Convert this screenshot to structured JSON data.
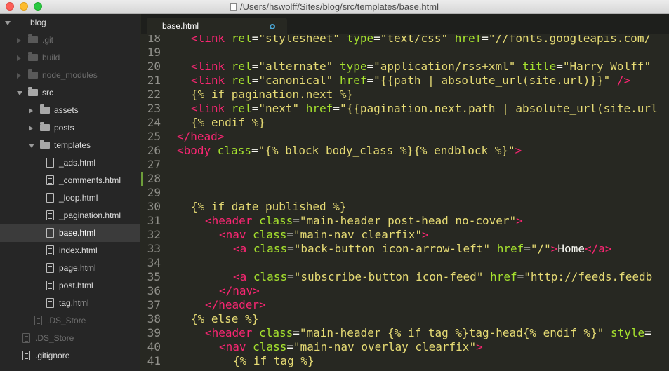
{
  "window": {
    "title": "/Users/hswolff/Sites/blog/src/templates/base.html"
  },
  "sidebar": {
    "items": [
      {
        "label": "blog",
        "depth": 0,
        "kind": "folder",
        "state": "open",
        "dim": false,
        "selected": false
      },
      {
        "label": ".git",
        "depth": 1,
        "kind": "folder",
        "state": "closed",
        "dim": true,
        "selected": false
      },
      {
        "label": "build",
        "depth": 1,
        "kind": "folder",
        "state": "closed",
        "dim": true,
        "selected": false
      },
      {
        "label": "node_modules",
        "depth": 1,
        "kind": "folder",
        "state": "closed",
        "dim": true,
        "selected": false
      },
      {
        "label": "src",
        "depth": 1,
        "kind": "folder",
        "state": "open",
        "dim": false,
        "selected": false
      },
      {
        "label": "assets",
        "depth": 2,
        "kind": "folder",
        "state": "closed",
        "dim": false,
        "selected": false
      },
      {
        "label": "posts",
        "depth": 2,
        "kind": "folder",
        "state": "closed",
        "dim": false,
        "selected": false
      },
      {
        "label": "templates",
        "depth": 2,
        "kind": "folder",
        "state": "open",
        "dim": false,
        "selected": false
      },
      {
        "label": "_ads.html",
        "depth": 3,
        "kind": "file",
        "dim": false,
        "selected": false
      },
      {
        "label": "_comments.html",
        "depth": 3,
        "kind": "file",
        "dim": false,
        "selected": false
      },
      {
        "label": "_loop.html",
        "depth": 3,
        "kind": "file",
        "dim": false,
        "selected": false
      },
      {
        "label": "_pagination.html",
        "depth": 3,
        "kind": "file",
        "dim": false,
        "selected": false
      },
      {
        "label": "base.html",
        "depth": 3,
        "kind": "file",
        "dim": false,
        "selected": true
      },
      {
        "label": "index.html",
        "depth": 3,
        "kind": "file",
        "dim": false,
        "selected": false
      },
      {
        "label": "page.html",
        "depth": 3,
        "kind": "file",
        "dim": false,
        "selected": false
      },
      {
        "label": "post.html",
        "depth": 3,
        "kind": "file",
        "dim": false,
        "selected": false
      },
      {
        "label": "tag.html",
        "depth": 3,
        "kind": "file",
        "dim": false,
        "selected": false
      },
      {
        "label": ".DS_Store",
        "depth": 2,
        "kind": "file",
        "dim": true,
        "selected": false
      },
      {
        "label": ".DS_Store",
        "depth": 1,
        "kind": "file",
        "dim": true,
        "selected": false
      },
      {
        "label": ".gitignore",
        "depth": 1,
        "kind": "file",
        "dim": false,
        "selected": false
      }
    ]
  },
  "tabs": [
    {
      "label": "base.html",
      "active": true,
      "dirty": true
    }
  ],
  "editor": {
    "current_line": 28,
    "lines": [
      {
        "n": "18",
        "indent": 1,
        "tokens": [
          [
            "tag",
            "<link "
          ],
          [
            "attr",
            "rel"
          ],
          [
            "plain",
            "="
          ],
          [
            "str",
            "\"stylesheet\" "
          ],
          [
            "attr",
            "type"
          ],
          [
            "plain",
            "="
          ],
          [
            "str",
            "\"text/css\" "
          ],
          [
            "attr",
            "href"
          ],
          [
            "plain",
            "="
          ],
          [
            "str",
            "\"//fonts.googleapis.com/"
          ]
        ]
      },
      {
        "n": "19",
        "indent": 0,
        "tokens": []
      },
      {
        "n": "20",
        "indent": 1,
        "tokens": [
          [
            "tag",
            "<link "
          ],
          [
            "attr",
            "rel"
          ],
          [
            "plain",
            "="
          ],
          [
            "str",
            "\"alternate\" "
          ],
          [
            "attr",
            "type"
          ],
          [
            "plain",
            "="
          ],
          [
            "str",
            "\"application/rss+xml\" "
          ],
          [
            "attr",
            "title"
          ],
          [
            "plain",
            "="
          ],
          [
            "str",
            "\"Harry Wolff\""
          ]
        ]
      },
      {
        "n": "21",
        "indent": 1,
        "tokens": [
          [
            "tag",
            "<link "
          ],
          [
            "attr",
            "rel"
          ],
          [
            "plain",
            "="
          ],
          [
            "str",
            "\"canonical\" "
          ],
          [
            "attr",
            "href"
          ],
          [
            "plain",
            "="
          ],
          [
            "str",
            "\"{{path | absolute_url(site.url)}}\" "
          ],
          [
            "tag",
            "/>"
          ]
        ]
      },
      {
        "n": "22",
        "indent": 1,
        "tokens": [
          [
            "tpl",
            "{% if pagination.next %}"
          ]
        ]
      },
      {
        "n": "23",
        "indent": 1,
        "tokens": [
          [
            "tag",
            "<link "
          ],
          [
            "attr",
            "rel"
          ],
          [
            "plain",
            "="
          ],
          [
            "str",
            "\"next\" "
          ],
          [
            "attr",
            "href"
          ],
          [
            "plain",
            "="
          ],
          [
            "str",
            "\"{{pagination.next.path | absolute_url(site.url"
          ]
        ]
      },
      {
        "n": "24",
        "indent": 1,
        "tokens": [
          [
            "tpl",
            "{% endif %}"
          ]
        ]
      },
      {
        "n": "25",
        "indent": 0,
        "tokens": [
          [
            "tag",
            "</head>"
          ]
        ]
      },
      {
        "n": "26",
        "indent": 0,
        "tokens": [
          [
            "tag",
            "<body "
          ],
          [
            "attr",
            "class"
          ],
          [
            "plain",
            "="
          ],
          [
            "str",
            "\"{% block body_class %}{% endblock %}\""
          ],
          [
            "tag",
            ">"
          ]
        ]
      },
      {
        "n": "27",
        "indent": 0,
        "tokens": []
      },
      {
        "n": "28",
        "indent": 0,
        "tokens": []
      },
      {
        "n": "29",
        "indent": 0,
        "tokens": []
      },
      {
        "n": "30",
        "indent": 1,
        "tokens": [
          [
            "tpl",
            "{% if date_published %}"
          ]
        ]
      },
      {
        "n": "31",
        "indent": 2,
        "tokens": [
          [
            "tag",
            "<header "
          ],
          [
            "attr",
            "class"
          ],
          [
            "plain",
            "="
          ],
          [
            "str",
            "\"main-header post-head no-cover\""
          ],
          [
            "tag",
            ">"
          ]
        ]
      },
      {
        "n": "32",
        "indent": 3,
        "tokens": [
          [
            "tag",
            "<nav "
          ],
          [
            "attr",
            "class"
          ],
          [
            "plain",
            "="
          ],
          [
            "str",
            "\"main-nav clearfix\""
          ],
          [
            "tag",
            ">"
          ]
        ]
      },
      {
        "n": "33",
        "indent": 4,
        "tokens": [
          [
            "tag",
            "<a "
          ],
          [
            "attr",
            "class"
          ],
          [
            "plain",
            "="
          ],
          [
            "str",
            "\"back-button icon-arrow-left\" "
          ],
          [
            "attr",
            "href"
          ],
          [
            "plain",
            "="
          ],
          [
            "str",
            "\"/\""
          ],
          [
            "tag",
            ">"
          ],
          [
            "plain",
            "Home"
          ],
          [
            "tag",
            "</a>"
          ]
        ]
      },
      {
        "n": "34",
        "indent": 0,
        "tokens": []
      },
      {
        "n": "35",
        "indent": 4,
        "tokens": [
          [
            "tag",
            "<a "
          ],
          [
            "attr",
            "class"
          ],
          [
            "plain",
            "="
          ],
          [
            "str",
            "\"subscribe-button icon-feed\" "
          ],
          [
            "attr",
            "href"
          ],
          [
            "plain",
            "="
          ],
          [
            "str",
            "\"http://feeds.feedb"
          ]
        ]
      },
      {
        "n": "36",
        "indent": 3,
        "tokens": [
          [
            "tag",
            "</nav>"
          ]
        ]
      },
      {
        "n": "37",
        "indent": 2,
        "tokens": [
          [
            "tag",
            "</header>"
          ]
        ]
      },
      {
        "n": "38",
        "indent": 1,
        "tokens": [
          [
            "tpl",
            "{% else %}"
          ]
        ]
      },
      {
        "n": "39",
        "indent": 2,
        "tokens": [
          [
            "tag",
            "<header "
          ],
          [
            "attr",
            "class"
          ],
          [
            "plain",
            "="
          ],
          [
            "str",
            "\"main-header {% if tag %}tag-head{% endif %}\" "
          ],
          [
            "attr",
            "style"
          ],
          [
            "plain",
            "="
          ]
        ]
      },
      {
        "n": "40",
        "indent": 3,
        "tokens": [
          [
            "tag",
            "<nav "
          ],
          [
            "attr",
            "class"
          ],
          [
            "plain",
            "="
          ],
          [
            "str",
            "\"main-nav overlay clearfix\""
          ],
          [
            "tag",
            ">"
          ]
        ]
      },
      {
        "n": "41",
        "indent": 4,
        "tokens": [
          [
            "tpl",
            "{% if tag %}"
          ]
        ]
      }
    ]
  }
}
